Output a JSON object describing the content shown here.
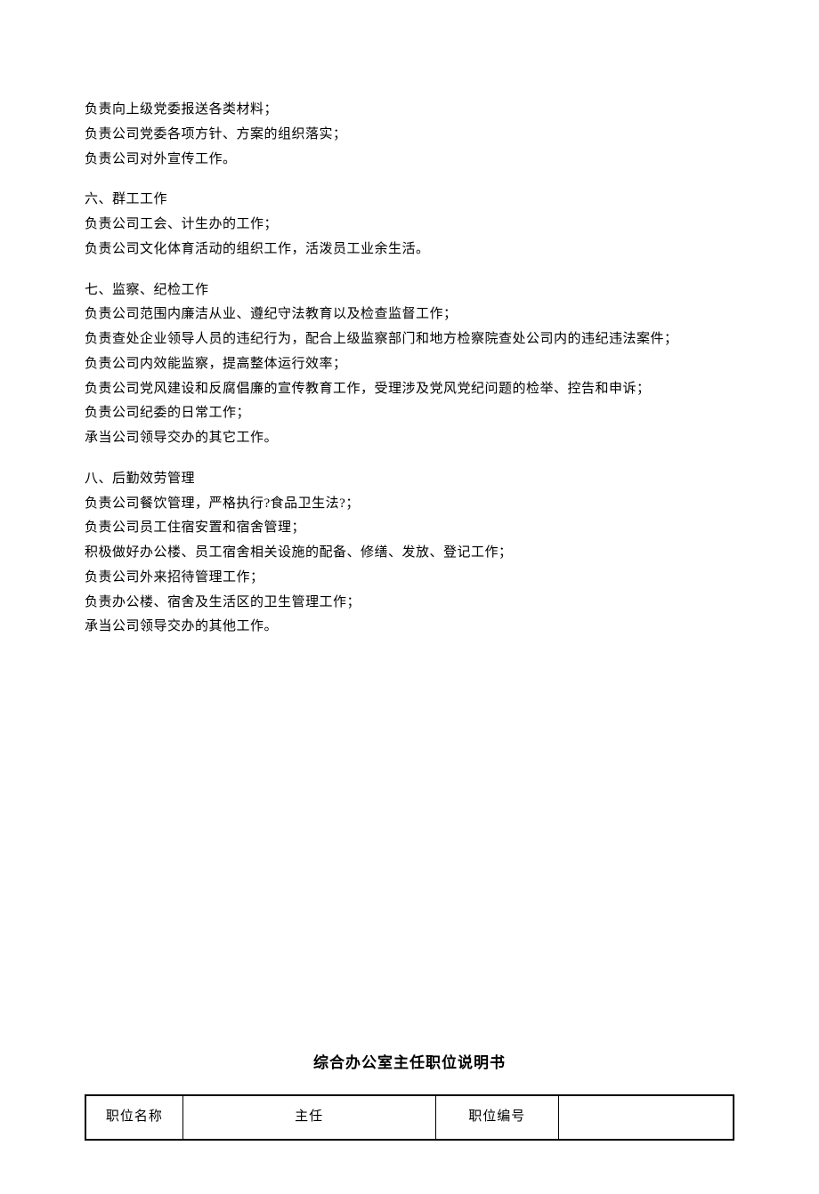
{
  "blocks": {
    "intro": [
      "负责向上级党委报送各类材料；",
      "负责公司党委各项方针、方案的组织落实；",
      "负责公司对外宣传工作。"
    ],
    "s6": {
      "title": "六、群工工作",
      "items": [
        "负责公司工会、计生办的工作；",
        "负责公司文化体育活动的组织工作，活泼员工业余生活。"
      ]
    },
    "s7": {
      "title": "七、监察、纪检工作",
      "items": [
        "负责公司范围内廉洁从业、遵纪守法教育以及检查监督工作；",
        "负责查处企业领导人员的违纪行为，配合上级监察部门和地方检察院查处公司内的违纪违法案件；",
        "负责公司内效能监察，提高整体运行效率；",
        "负责公司党风建设和反腐倡廉的宣传教育工作，受理涉及党风党纪问题的检举、控告和申诉；",
        "负责公司纪委的日常工作；",
        "承当公司领导交办的其它工作。"
      ]
    },
    "s8": {
      "title": "八、后勤效劳管理",
      "items": [
        "负责公司餐饮管理，严格执行?食品卫生法?；",
        "负责公司员工住宿安置和宿舍管理；",
        "积极做好办公楼、员工宿舍相关设施的配备、修缮、发放、登记工作；",
        "负责公司外来招待管理工作；",
        "负责办公楼、宿舍及生活区的卫生管理工作；",
        "承当公司领导交办的其他工作。"
      ]
    }
  },
  "table": {
    "title": "综合办公室主任职位说明书",
    "row": {
      "c1": "职位名称",
      "c2": "主任",
      "c3": "职位编号",
      "c4": ""
    }
  }
}
